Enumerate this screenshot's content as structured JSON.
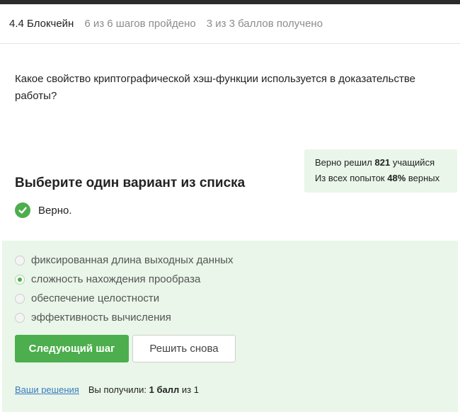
{
  "header": {
    "lesson": "4.4 Блокчейн",
    "steps_progress": "6 из 6 шагов пройдено",
    "points_progress": "3 из 3 баллов  получено"
  },
  "question": {
    "text": "Какое свойство криптографической хэш-функции используется в доказательстве работы?"
  },
  "stats": {
    "line1_prefix": "Верно решил",
    "solved_count": "821",
    "line1_suffix": "учащийся",
    "line2_prefix": "Из всех попыток",
    "correct_percent": "48%",
    "line2_suffix": "верных"
  },
  "task": {
    "title": "Выберите один вариант из списка",
    "verdict": "Верно."
  },
  "options": [
    {
      "label": "фиксированная длина выходных данных",
      "selected": false
    },
    {
      "label": "сложность нахождения прообраза",
      "selected": true
    },
    {
      "label": "обеспечение целостности",
      "selected": false
    },
    {
      "label": "эффективность вычисления",
      "selected": false
    }
  ],
  "buttons": {
    "next": "Следующий шаг",
    "retry": "Решить снова"
  },
  "footer": {
    "solutions_link": "Ваши решения",
    "score_prefix": "Вы получили:",
    "score_value": "1 балл",
    "score_suffix": "из 1"
  },
  "colors": {
    "accent_green": "#4cae4c",
    "panel_green": "#e9f6e9",
    "link_blue": "#3b7bbf"
  },
  "icons": {
    "verdict": "check-circle-icon"
  }
}
